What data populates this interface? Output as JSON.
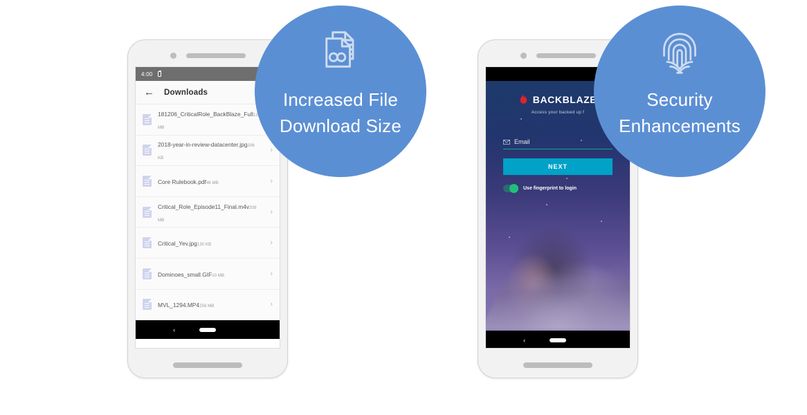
{
  "background_color": "#ffffff",
  "accent_color": "#5b8fd4",
  "phones": [
    {
      "name": "downloads-phone",
      "status_bar": {
        "time": "4:00",
        "battery_icon": "battery-icon",
        "background": "#6e6e6e"
      },
      "appbar": {
        "back_icon": "back-arrow-icon",
        "title": "Downloads"
      },
      "files": [
        {
          "name": "181206_CriticalRole_BackBlaze_Full",
          "size": "121 MB",
          "icon": "document-icon",
          "chevron": "chevron-right-icon"
        },
        {
          "name": "2018-year-in-review-datacenter.jpg",
          "size": "206 KB",
          "icon": "document-icon",
          "chevron": "chevron-right-icon"
        },
        {
          "name": "Core Rulebook.pdf",
          "size": "46 MB",
          "icon": "document-icon",
          "chevron": "chevron-right-icon"
        },
        {
          "name": "Critical_Role_Episode11_Final.m4v",
          "size": "209 MB",
          "icon": "document-icon",
          "chevron": "chevron-right-icon"
        },
        {
          "name": "Critical_Yev.jpg",
          "size": "130 KB",
          "icon": "document-icon",
          "chevron": "chevron-right-icon"
        },
        {
          "name": "Dominoes_small.GIF",
          "size": "10 MB",
          "icon": "document-icon",
          "chevron": "chevron-right-icon"
        },
        {
          "name": "MVL_1294.MP4",
          "size": "256 MB",
          "icon": "document-icon",
          "chevron": "chevron-right-icon"
        }
      ],
      "navbar": {
        "back_icon": "nav-back-icon",
        "home_pill": "nav-home-pill"
      }
    },
    {
      "name": "login-phone",
      "status_bar": {
        "background": "#000000"
      },
      "brand": {
        "logo_icon": "backblaze-flame-icon",
        "name": "BACKBLAZE",
        "subtitle": "Access your backed up f"
      },
      "form": {
        "email_icon": "envelope-icon",
        "email_label": "Email",
        "email_value": "",
        "email_placeholder": "Email",
        "next_label": "NEXT",
        "next_color": "#00a2c7",
        "fingerprint_toggle_label": "Use fingerprint to login",
        "fingerprint_toggle_state": "on",
        "toggle_on_color": "#21c07a"
      },
      "navbar": {
        "back_icon": "nav-back-icon",
        "home_pill": "nav-home-pill"
      }
    }
  ],
  "badges": [
    {
      "icon": "documents-infinity-icon",
      "text": "Increased File\nDownload Size",
      "color": "#5b8fd4"
    },
    {
      "icon": "fingerprint-icon",
      "text": "Security\nEnhancements",
      "color": "#5b8fd4"
    }
  ]
}
